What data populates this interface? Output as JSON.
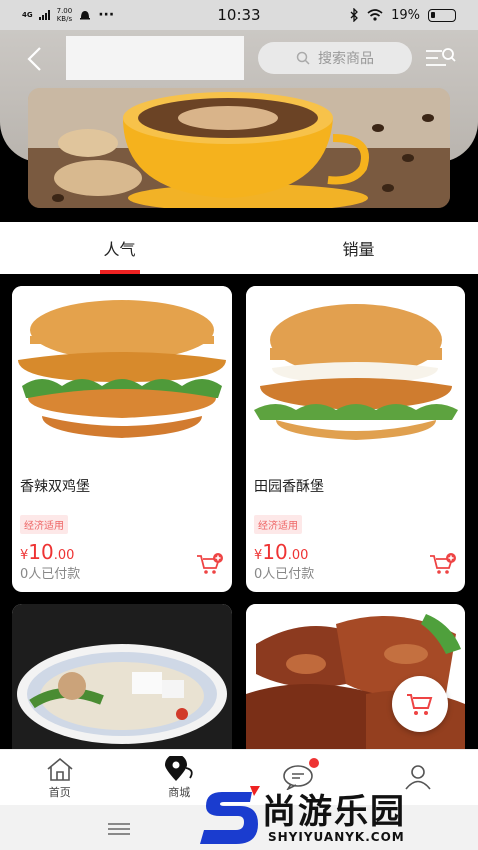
{
  "status_bar": {
    "network": "4G",
    "speed_value": "7.00",
    "speed_unit": "KB/s",
    "dots": "···",
    "time": "10:33",
    "battery": "19%"
  },
  "header": {
    "search_placeholder": "搜索商品"
  },
  "tabs": [
    {
      "label": "人气",
      "active": true
    },
    {
      "label": "销量",
      "active": false
    }
  ],
  "products": [
    {
      "name": "香辣双鸡堡",
      "tag": "经济适用",
      "currency": "¥",
      "price_int": "10",
      "price_dec": ".00",
      "sold": "0人已付款"
    },
    {
      "name": "田园香酥堡",
      "tag": "经济适用",
      "currency": "¥",
      "price_int": "10",
      "price_dec": ".00",
      "sold": "0人已付款"
    },
    {
      "name": "",
      "tag": "",
      "currency": "",
      "price_int": "",
      "price_dec": "",
      "sold": ""
    },
    {
      "name": "",
      "tag": "",
      "currency": "",
      "price_int": "",
      "price_dec": "",
      "sold": ""
    }
  ],
  "bottom_nav": [
    {
      "label": "首页",
      "icon": "home-icon"
    },
    {
      "label": "商城",
      "icon": "location-icon"
    },
    {
      "label": "",
      "icon": "chat-icon"
    },
    {
      "label": "",
      "icon": "user-icon"
    }
  ],
  "watermark": {
    "text": "尚游乐园",
    "url": "SHYIYUANYK.COM"
  },
  "colors": {
    "accent": "#e22222",
    "price": "#e33333",
    "watermark_blue": "#1a3ccf"
  }
}
